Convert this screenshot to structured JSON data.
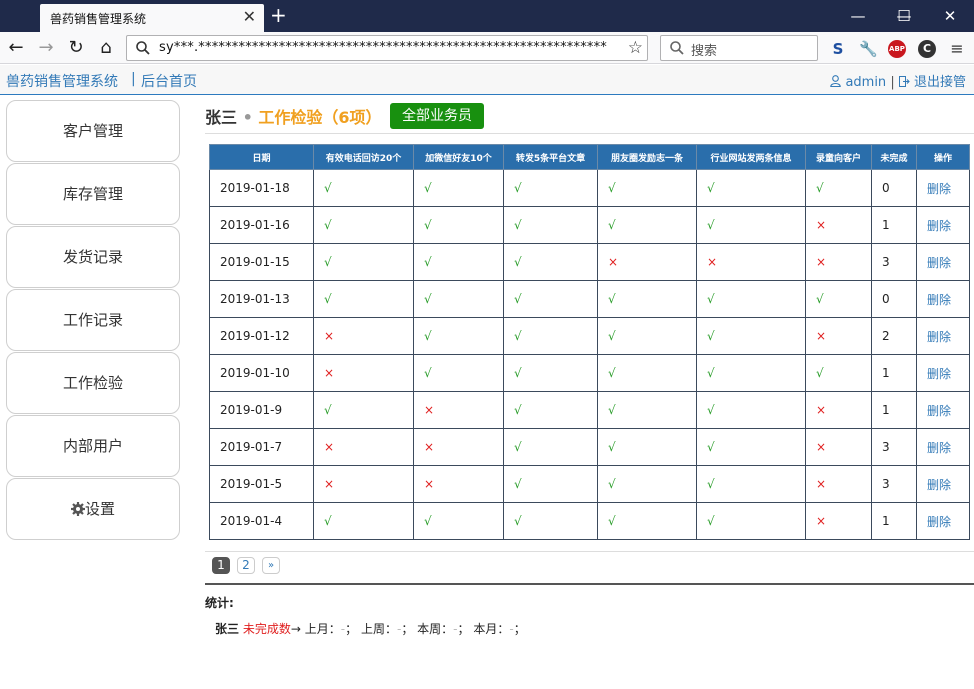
{
  "browser": {
    "tab_title": "兽药销售管理系统",
    "tab_close": "✕",
    "new_tab": "+",
    "url": "sy***.*************************************************************",
    "search_placeholder": "搜索",
    "window_controls": [
      "—",
      "☐",
      "✕"
    ]
  },
  "app": {
    "title": "兽药销售管理系统",
    "separator": "|",
    "home": "后台首页",
    "user": "admin",
    "user_sep": "|",
    "logout": "退出接管"
  },
  "sidebar": {
    "items": [
      {
        "label": "客户管理"
      },
      {
        "label": "库存管理"
      },
      {
        "label": "发货记录"
      },
      {
        "label": "工作记录"
      },
      {
        "label": "工作检验"
      },
      {
        "label": "内部用户"
      },
      {
        "label": "设置"
      }
    ]
  },
  "heading": {
    "name": "张三",
    "dot": "•",
    "title": "工作检验（6项）",
    "all_button": "全部业务员"
  },
  "table": {
    "headers": [
      "日期",
      "有效电话回访20个",
      "加微信好友10个",
      "转发5条平台文章",
      "朋友圈发励志一条",
      "行业网站发两条信息",
      "录童向客户",
      "未完成",
      "操作"
    ],
    "rows": [
      {
        "date": "2019-01-18",
        "c1": "√",
        "c2": "√",
        "c3": "√",
        "c4": "√",
        "c5": "√",
        "c6": "√",
        "incomplete": "0",
        "action": "删除"
      },
      {
        "date": "2019-01-16",
        "c1": "√",
        "c2": "√",
        "c3": "√",
        "c4": "√",
        "c5": "√",
        "c6": "×",
        "incomplete": "1",
        "action": "删除"
      },
      {
        "date": "2019-01-15",
        "c1": "√",
        "c2": "√",
        "c3": "√",
        "c4": "×",
        "c5": "×",
        "c6": "×",
        "incomplete": "3",
        "action": "删除"
      },
      {
        "date": "2019-01-13",
        "c1": "√",
        "c2": "√",
        "c3": "√",
        "c4": "√",
        "c5": "√",
        "c6": "√",
        "incomplete": "0",
        "action": "删除"
      },
      {
        "date": "2019-01-12",
        "c1": "×",
        "c2": "√",
        "c3": "√",
        "c4": "√",
        "c5": "√",
        "c6": "×",
        "incomplete": "2",
        "action": "删除"
      },
      {
        "date": "2019-01-10",
        "c1": "×",
        "c2": "√",
        "c3": "√",
        "c4": "√",
        "c5": "√",
        "c6": "√",
        "incomplete": "1",
        "action": "删除"
      },
      {
        "date": "2019-01-9",
        "c1": "√",
        "c2": "×",
        "c3": "√",
        "c4": "√",
        "c5": "√",
        "c6": "×",
        "incomplete": "1",
        "action": "删除"
      },
      {
        "date": "2019-01-7",
        "c1": "×",
        "c2": "×",
        "c3": "√",
        "c4": "√",
        "c5": "√",
        "c6": "×",
        "incomplete": "3",
        "action": "删除"
      },
      {
        "date": "2019-01-5",
        "c1": "×",
        "c2": "×",
        "c3": "√",
        "c4": "√",
        "c5": "√",
        "c6": "×",
        "incomplete": "3",
        "action": "删除"
      },
      {
        "date": "2019-01-4",
        "c1": "√",
        "c2": "√",
        "c3": "√",
        "c4": "√",
        "c5": "√",
        "c6": "×",
        "incomplete": "1",
        "action": "删除"
      }
    ]
  },
  "pagination": {
    "pages": [
      "1",
      "2"
    ],
    "next": "»",
    "current": "1"
  },
  "stats": {
    "label": "统计:",
    "name": "张三",
    "incomplete_label": "未完成数",
    "arrow": "→",
    "last_month": "上月：",
    "last_week": "上周：",
    "this_week": "本周：",
    "this_month": "本月：",
    "value_placeholder": "-",
    "separator": "；"
  },
  "colors": {
    "accent": "#337ab7",
    "header_bg": "#2a6eab",
    "button": "#18900f",
    "ok": "#2a9d2a",
    "no": "#e02020",
    "title": "#f0a020"
  }
}
